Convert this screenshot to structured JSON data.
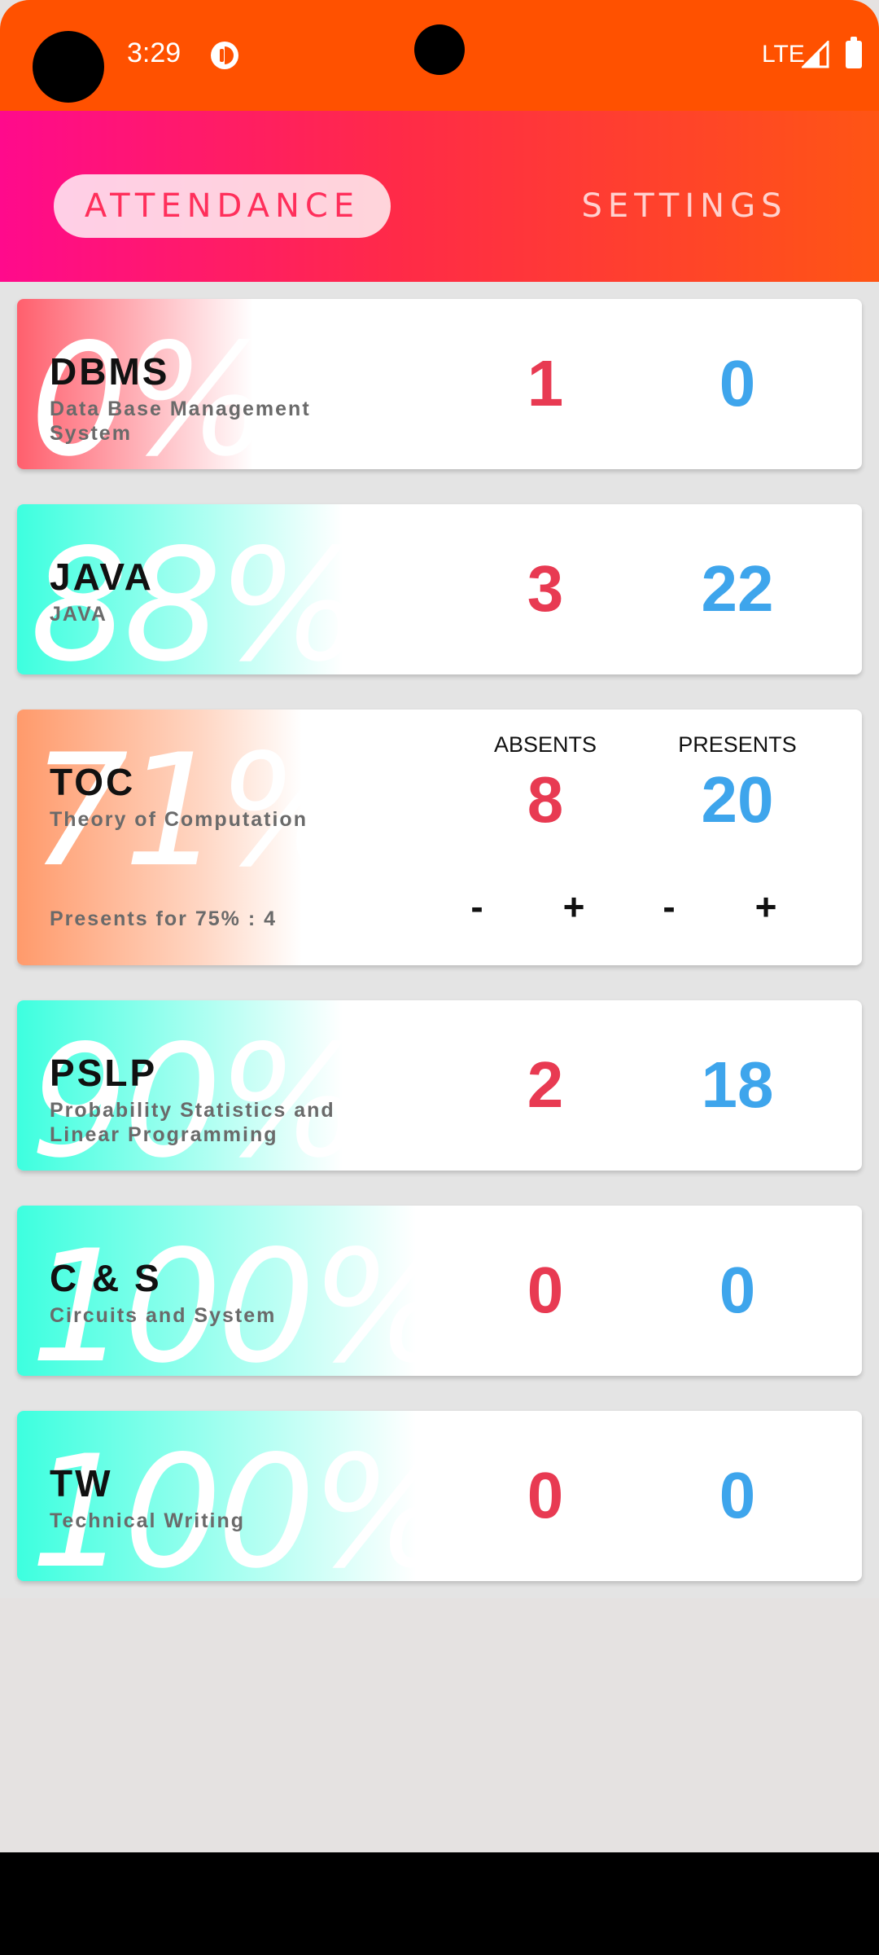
{
  "status_bar": {
    "time": "3:29",
    "network": "LTE",
    "icons": [
      "notification-app-icon",
      "signal-icon",
      "battery-icon"
    ]
  },
  "tabs": [
    {
      "label": "ATTENDANCE",
      "active": true
    },
    {
      "label": "SETTINGS",
      "active": false
    }
  ],
  "subjects": [
    {
      "code": "DBMS",
      "name": "Data Base Management System",
      "percent": "0%",
      "absents": "1",
      "presents": "0",
      "color": "#ff5f6d"
    },
    {
      "code": "JAVA",
      "name": "JAVA",
      "percent": "88%",
      "absents": "3",
      "presents": "22",
      "color": "#3dffdf"
    },
    {
      "code": "TOC",
      "name": "Theory of Computation",
      "percent": "71%",
      "absents": "8",
      "presents": "20",
      "color": "#ff9a6b",
      "absents_label": "ABSENTS",
      "presents_label": "PRESENTS",
      "needed_text": "Presents for 75% : 4",
      "stepper": {
        "minus": "-",
        "plus": "+"
      }
    },
    {
      "code": "PSLP",
      "name": "Probability Statistics and Linear Programming",
      "percent": "90%",
      "absents": "2",
      "presents": "18",
      "color": "#3dffdf"
    },
    {
      "code": "C & S",
      "name": "Circuits and System",
      "percent": "100%",
      "absents": "0",
      "presents": "0",
      "color": "#3dffdf"
    },
    {
      "code": "TW",
      "name": "Technical Writing",
      "percent": "100%",
      "absents": "0",
      "presents": "0",
      "color": "#3dffdf"
    }
  ]
}
